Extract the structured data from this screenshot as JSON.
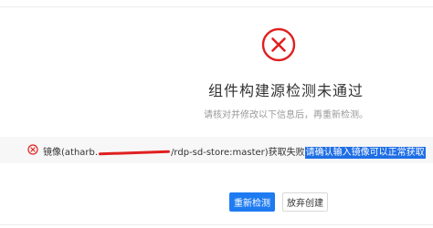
{
  "result": {
    "title": "组件构建源检测未通过",
    "subtitle": "请核对并修改以下信息后，再重新检测。"
  },
  "error": {
    "text_prefix": "镜像(atharb.",
    "text_suffix": "/rdp-sd-store:master)获取失败",
    "highlight": "请确认输入镜像可以正常获取"
  },
  "actions": {
    "recheck_label": "重新检测",
    "abandon_label": "放弃创建"
  },
  "colors": {
    "error": "#e02020",
    "primary": "#1e7bf2",
    "highlight": "#1e6ee6"
  },
  "icons": {
    "status": "error-circle-x-icon",
    "inline": "error-small-circle-x-icon"
  }
}
